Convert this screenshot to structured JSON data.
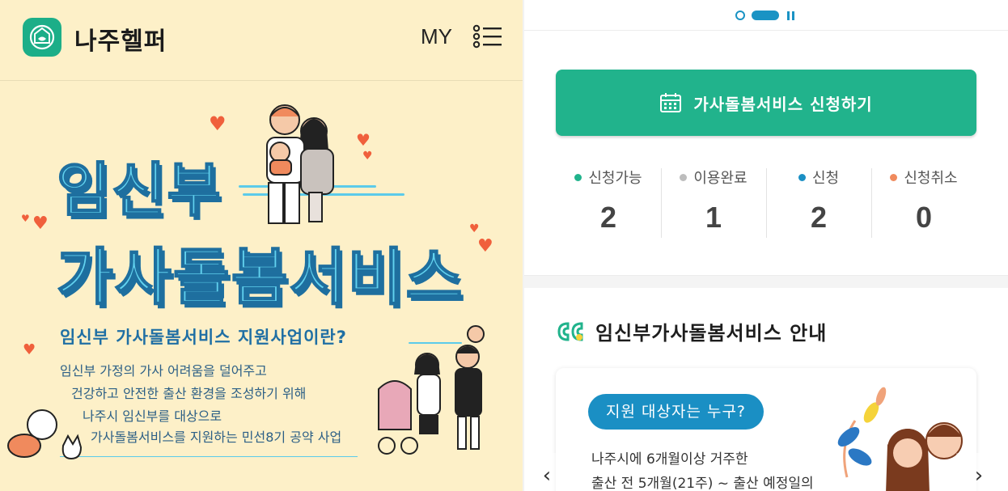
{
  "header": {
    "app_title": "나주헬퍼",
    "my_label": "MY",
    "logo_icon": "nest-logo-icon",
    "menu_icon": "menu-list-icon"
  },
  "banner": {
    "title_line1": "임신부",
    "title_line2": "가사돌봄서비스",
    "subtitle": "임신부 가사돌봄서비스 지원사업이란?",
    "description": [
      "임신부 가정의 가사 어려움을 덜어주고",
      "건강하고 안전한 출산 환경을 조성하기 위해",
      "나주시 임신부를 대상으로",
      "가사돌봄서비스를 지원하는 민선8기 공약 사업"
    ],
    "colors": {
      "background": "#fdf0c8",
      "title_fill": "#62d2ef",
      "title_outline": "#1e6f9f",
      "heart": "#f0603c"
    }
  },
  "carousel": {
    "indicator_icons": [
      "dot-ring-icon",
      "dot-active-icon",
      "pause-icon"
    ]
  },
  "apply": {
    "label": "가사돌봄서비스 신청하기",
    "icon": "calendar-icon",
    "color": "#21b38c"
  },
  "stats": [
    {
      "label": "신청가능",
      "count": "2",
      "color": "#21b38c"
    },
    {
      "label": "이용완료",
      "count": "1",
      "color": "#bdbdbd"
    },
    {
      "label": "신청",
      "count": "2",
      "color": "#1a8fc4"
    },
    {
      "label": "신청취소",
      "count": "0",
      "color": "#f08a5d"
    }
  ],
  "guide": {
    "title": "임신부가사돌봄서비스 안내",
    "icon": "quote-icon",
    "card": {
      "pill": "지원 대상자는 누구?",
      "lines": [
        "나주시에 6개월이상 거주한",
        "출산 전 5개월(21주) ~ 출산 예정일의"
      ]
    },
    "prev_icon": "chevron-left-icon",
    "next_icon": "chevron-right-icon"
  }
}
